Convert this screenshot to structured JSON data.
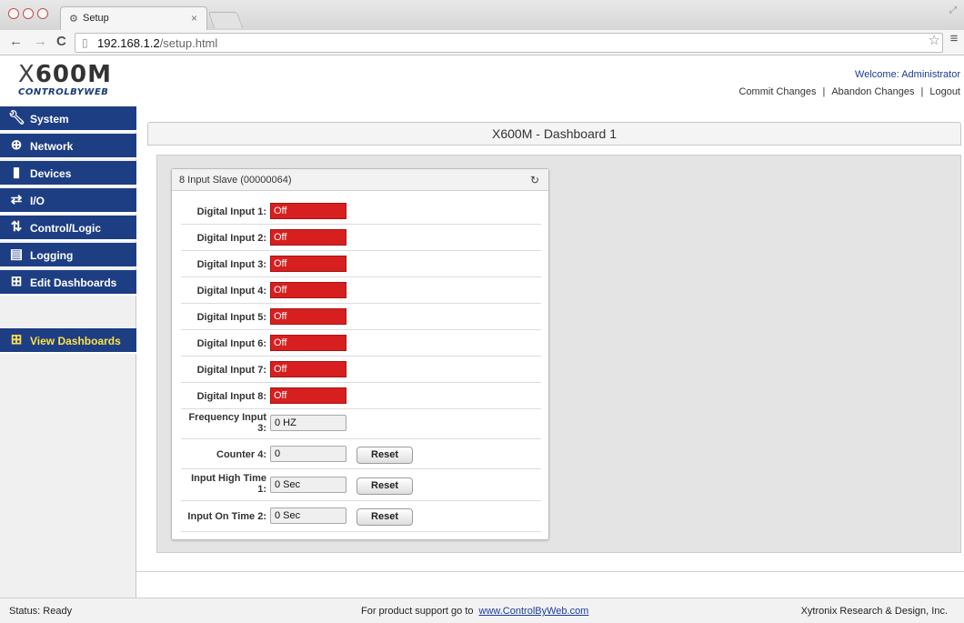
{
  "browser": {
    "tab_title": "Setup",
    "tab_close": "×",
    "url_host": "192.168.1.2",
    "url_path": "/setup.html"
  },
  "header": {
    "logo_main": "X600M",
    "logo_sub": "CONTROLBYWEB",
    "welcome": "Welcome: Administrator",
    "links": [
      "Commit Changes",
      "Abandon Changes",
      "Logout"
    ]
  },
  "sidebar": {
    "items": [
      {
        "label": "System",
        "icon": "wrench-icon"
      },
      {
        "label": "Network",
        "icon": "globe-icon"
      },
      {
        "label": "Devices",
        "icon": "device-icon"
      },
      {
        "label": "I/O",
        "icon": "io-arrows-icon"
      },
      {
        "label": "Control/Logic",
        "icon": "control-logic-icon"
      },
      {
        "label": "Logging",
        "icon": "log-icon"
      },
      {
        "label": "Edit Dashboards",
        "icon": "dashboard-icon"
      }
    ],
    "active_item": {
      "label": "View Dashboards",
      "icon": "dashboard-icon"
    },
    "active_color": "#ffe14a",
    "item_bg": "#1e3e84"
  },
  "main": {
    "dashboard_title": "X600M - Dashboard 1",
    "widget": {
      "title": "8 Input Slave (00000064)",
      "digital_inputs": [
        {
          "label": "Digital Input 1:",
          "state": "Off"
        },
        {
          "label": "Digital Input 2:",
          "state": "Off"
        },
        {
          "label": "Digital Input 3:",
          "state": "Off"
        },
        {
          "label": "Digital Input 4:",
          "state": "Off"
        },
        {
          "label": "Digital Input 5:",
          "state": "Off"
        },
        {
          "label": "Digital Input 6:",
          "state": "Off"
        },
        {
          "label": "Digital Input 7:",
          "state": "Off"
        },
        {
          "label": "Digital Input 8:",
          "state": "Off"
        }
      ],
      "off_color": "#d81f1f",
      "frequency": {
        "label_line1": "Frequency Input",
        "label_line2": "3:",
        "value": "0 HZ"
      },
      "counter": {
        "label": "Counter 4:",
        "value": "0",
        "button": "Reset"
      },
      "high_time": {
        "label_line1": "Input High Time",
        "label_line2": "1:",
        "value": "0 Sec",
        "button": "Reset"
      },
      "on_time": {
        "label": "Input On Time 2:",
        "value": "0 Sec",
        "button": "Reset"
      }
    }
  },
  "footer": {
    "status": "Status:  Ready",
    "support_text": "For product support go to",
    "support_link": "www.ControlByWeb.com",
    "company": "Xytronix Research & Design, Inc."
  }
}
